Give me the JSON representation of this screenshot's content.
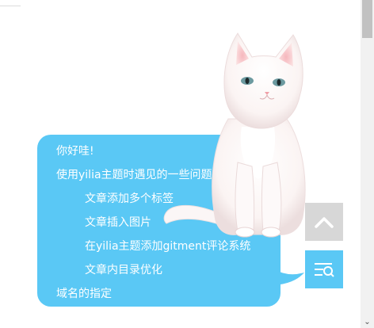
{
  "toc": {
    "items": [
      {
        "label": "你好哇!",
        "level": 1
      },
      {
        "label": "使用yilia主题时遇见的一些问题",
        "level": 1
      },
      {
        "label": "文章添加多个标签",
        "level": 2
      },
      {
        "label": "文章插入图片",
        "level": 2
      },
      {
        "label": "在yilia主题添加gitment评论系统",
        "level": 2
      },
      {
        "label": "文章内目录优化",
        "level": 2
      },
      {
        "label": "域名的指定",
        "level": 1
      }
    ]
  },
  "buttons": {
    "back_to_top_icon": "chevron-up-icon",
    "toc_toggle_icon": "toc-list-search-icon"
  },
  "colors": {
    "toc_background": "#5ac8f5",
    "back_to_top_background": "#d7d7d7",
    "toc_button_background": "#5ac8f5"
  }
}
